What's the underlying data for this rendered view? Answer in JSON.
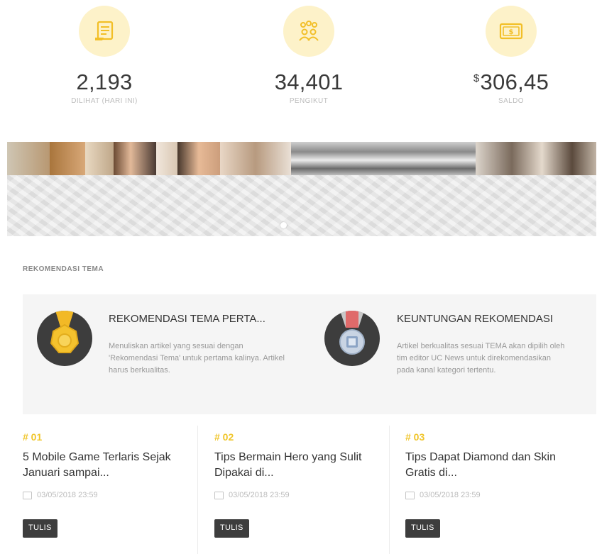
{
  "stats": [
    {
      "value": "2,193",
      "currency": "",
      "label": "DILIHAT (HARI INI)",
      "icon": "document-icon"
    },
    {
      "value": "34,401",
      "currency": "",
      "label": "PENGIKUT",
      "icon": "followers-icon"
    },
    {
      "value": "306,45",
      "currency": "$",
      "label": "SALDO",
      "icon": "money-icon"
    }
  ],
  "section": {
    "title": "REKOMENDASI TEMA"
  },
  "recommendations": [
    {
      "title": "REKOMENDASI TEMA PERTA...",
      "description": "Menuliskan artikel yang sesuai dengan 'Rekomendasi Tema' untuk pertama kalinya. Artikel harus berkualitas.",
      "icon": "gold-medal-icon"
    },
    {
      "title": "KEUNTUNGAN REKOMENDASI",
      "description": "Artikel berkualitas sesuai TEMA akan dipilih oleh tim editor UC News untuk direkomendasikan pada kanal kategori tertentu.",
      "icon": "silver-medal-icon"
    }
  ],
  "articles": [
    {
      "rank": "# 01",
      "title": "5 Mobile Game Terlaris Sejak Januari sampai...",
      "date": "03/05/2018 23:59",
      "button": "TULIS"
    },
    {
      "rank": "# 02",
      "title": "Tips Bermain Hero yang Sulit Dipakai di...",
      "date": "03/05/2018 23:59",
      "button": "TULIS"
    },
    {
      "rank": "# 03",
      "title": "Tips Dapat Diamond dan Skin Gratis di...",
      "date": "03/05/2018 23:59",
      "button": "TULIS"
    }
  ],
  "colors": {
    "accent": "#f0c52a",
    "icon_bg": "#fdf2c9",
    "button_bg": "#3d3d3d"
  }
}
